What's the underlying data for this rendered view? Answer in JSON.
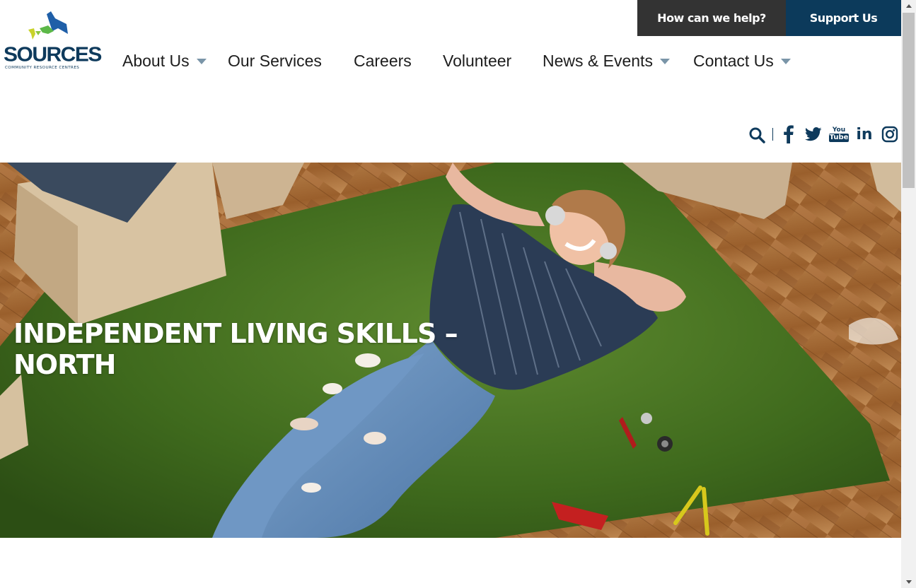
{
  "header": {
    "help_label": "How can we help?",
    "support_label": "Support Us"
  },
  "logo": {
    "name": "SOURCES",
    "tagline": "COMMUNITY RESOURCE CENTRES",
    "icon": "birds-logo"
  },
  "nav": {
    "items": [
      {
        "label": "About Us",
        "has_dropdown": true
      },
      {
        "label": "Our Services",
        "has_dropdown": false
      },
      {
        "label": "Careers",
        "has_dropdown": false
      },
      {
        "label": "Volunteer",
        "has_dropdown": false
      },
      {
        "label": "News & Events",
        "has_dropdown": true
      },
      {
        "label": "Contact Us",
        "has_dropdown": true
      }
    ]
  },
  "social": {
    "icons": [
      "search-icon",
      "facebook-icon",
      "twitter-icon",
      "youtube-icon",
      "linkedin-icon",
      "instagram-icon"
    ],
    "youtube_text": [
      "You",
      "Tube"
    ],
    "linkedin_text": "in"
  },
  "hero": {
    "title": "INDEPENDENT LIVING SKILLS – NORTH"
  },
  "colors": {
    "brand_navy": "#0c3a5b",
    "help_bg": "#333333",
    "caret": "#7a95a8"
  }
}
